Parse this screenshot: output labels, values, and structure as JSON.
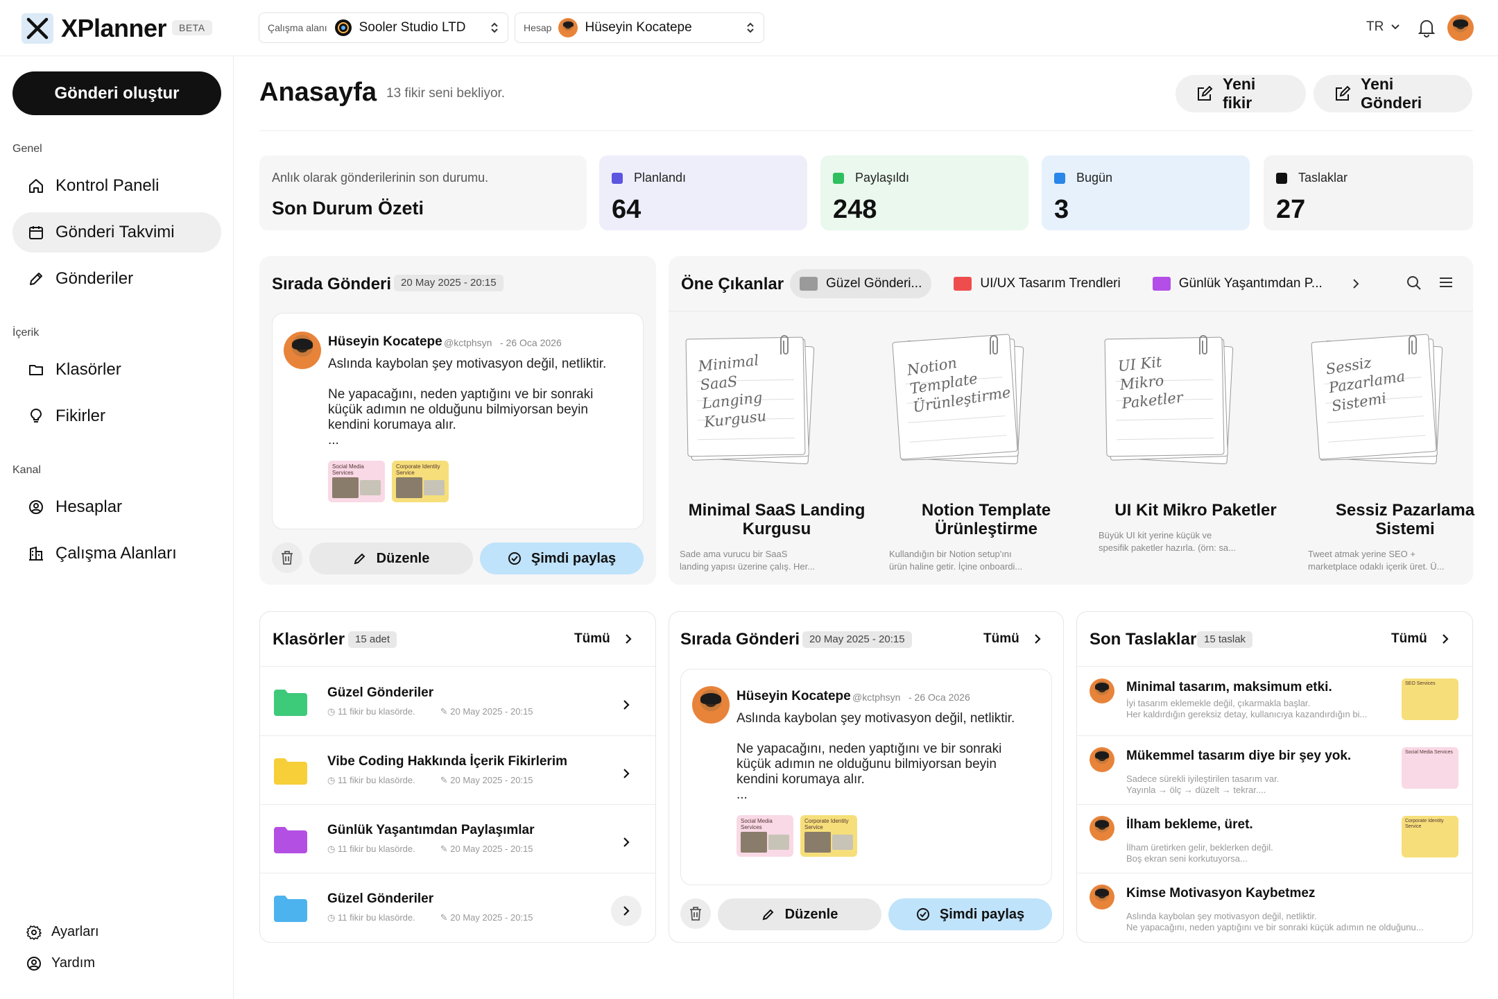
{
  "brand": {
    "name": "XPlanner",
    "badge": "BETA"
  },
  "workspace": {
    "label": "Çalışma alanı",
    "value": "Sooler Studio LTD"
  },
  "account": {
    "label": "Hesap",
    "value": "Hüseyin Kocatepe"
  },
  "lang": "TR",
  "sidebar": {
    "create": "Gönderi oluştur",
    "groups": [
      "Genel",
      "İçerik",
      "Kanal"
    ],
    "items": [
      "Kontrol Paneli",
      "Gönderi Takvimi",
      "Gönderiler",
      "Klasörler",
      "Fikirler",
      "Hesaplar",
      "Çalışma Alanları"
    ],
    "footer": [
      "Ayarları",
      "Yardım"
    ]
  },
  "header": {
    "title": "Anasayfa",
    "subtitle": "13 fikir seni bekliyor.",
    "btn_idea": "Yeni fikir",
    "btn_post": "Yeni Gönderi"
  },
  "summary": {
    "caption": "Anlık olarak gönderilerinin son durumu.",
    "title": "Son Durum Özeti"
  },
  "stats": [
    {
      "label": "Planlandı",
      "value": "64",
      "color": "#5b55e0",
      "bg": "#eeeefb"
    },
    {
      "label": "Paylaşıldı",
      "value": "248",
      "color": "#2fbf5f",
      "bg": "#eaf8ee"
    },
    {
      "label": "Bugün",
      "value": "3",
      "color": "#2a86e8",
      "bg": "#e6f1fc"
    },
    {
      "label": "Taslaklar",
      "value": "27",
      "color": "#111111",
      "bg": "#f4f4f4"
    }
  ],
  "queue": {
    "title": "Sırada Gönderi",
    "date": "20 May 2025 - 20:15",
    "author": "Hüseyin Kocatepe",
    "handle": "@kctphsyn",
    "when": "- 26 Oca 2026",
    "line1": "Aslında kaybolan şey motivasyon değil, netliktir.",
    "line2": "Ne yapacağını, neden yaptığını ve bir sonraki",
    "line3": "küçük adımın ne olduğunu bilmiyorsan beyin",
    "line4": "kendini korumaya alır.",
    "line5": "...",
    "thumb1": "Social Media Services",
    "thumb2": "Corporate Identity Service",
    "edit": "Düzenle",
    "share": "Şimdi paylaş"
  },
  "featured": {
    "title": "Öne Çıkanlar",
    "tabs": [
      {
        "label": "Güzel Gönderi...",
        "color": "#9a9a9a"
      },
      {
        "label": "UI/UX Tasarım Trendleri",
        "color": "#ef4d4d"
      },
      {
        "label": "Günlük Yaşantımdan P...",
        "color": "#b34ee8"
      }
    ],
    "items": [
      {
        "note": "Minimal\nSaaS\nLanging\nKurgusu",
        "title": "Minimal SaaS Landing Kurgusu",
        "desc1": "Sade ama vurucu bir SaaS",
        "desc2": "landing yapısı üzerine çalış. Her..."
      },
      {
        "note": "Notion\nTemplate\nÜrünleştirme",
        "title": "Notion Template Ürünleştirme",
        "desc1": "Kullandığın bir Notion setup'ını",
        "desc2": "ürün haline getir. İçine onboardi..."
      },
      {
        "note": "UI Kit\nMikro\nPaketler",
        "title": "UI Kit Mikro Paketler",
        "desc1": "Büyük UI kit yerine küçük ve",
        "desc2": "spesifik paketler hazırla. (örn: sa..."
      },
      {
        "note": "Sessiz\nPazarlama\nSistemi",
        "title": "Sessiz Pazarlama Sistemi",
        "desc1": "Tweet atmak yerine SEO +",
        "desc2": "marketplace odaklı içerik üret. Ü..."
      }
    ]
  },
  "folders": {
    "title": "Klasörler",
    "count": "15 adet",
    "all": "Tümü",
    "rows": [
      {
        "name": "Güzel Gönderiler",
        "meta": "11 fikir bu klasörde.",
        "date": "20 May 2025 - 20:15",
        "color": "#3ec97a"
      },
      {
        "name": "Vibe Coding Hakkında İçerik Fikirlerim",
        "meta": "11 fikir bu klasörde.",
        "date": "20 May 2025 - 20:15",
        "color": "#f5cf3a"
      },
      {
        "name": "Günlük Yaşantımdan Paylaşımlar",
        "meta": "11 fikir bu klasörde.",
        "date": "20 May 2025 - 20:15",
        "color": "#b44fe3"
      },
      {
        "name": "Güzel Gönderiler",
        "meta": "11 fikir bu klasörde.",
        "date": "20 May 2025 - 20:15",
        "color": "#4db3ef"
      }
    ]
  },
  "queue2": {
    "title": "Sırada Gönderi",
    "date": "20 May 2025 - 20:15",
    "all": "Tümü"
  },
  "drafts": {
    "title": "Son Taslaklar",
    "count": "15 taslak",
    "all": "Tümü",
    "rows": [
      {
        "title": "Minimal tasarım, maksimum etki.",
        "d1": "İyi tasarım eklemekle değil, çıkarmakla başlar.",
        "d2": "Her kaldırdığın gereksiz detay, kullanıcıya kazandırdığın bi...",
        "thumb": "SEO Services",
        "tc": "#f6df7a"
      },
      {
        "title": "Mükemmel tasarım diye bir şey yok.",
        "d1": "Sadece sürekli iyileştirilen tasarım var.",
        "d2": "Yayınla → ölç → düzelt → tekrar....",
        "thumb": "Social Media Services",
        "tc": "#f9d9e6"
      },
      {
        "title": "İlham bekleme, üret.",
        "d1": "İlham üretirken gelir, beklerken değil.",
        "d2": "Boş ekran seni korkutuyorsa...",
        "thumb": "Corporate Identity Service",
        "tc": "#f6df7a"
      },
      {
        "title": "Kimse Motivasyon Kaybetmez",
        "d1": "Aslında kaybolan şey motivasyon değil, netliktir.",
        "d2": "Ne yapacağını, neden yaptığını ve bir sonraki küçük adımın ne olduğunu...",
        "thumb": "",
        "tc": ""
      }
    ]
  }
}
